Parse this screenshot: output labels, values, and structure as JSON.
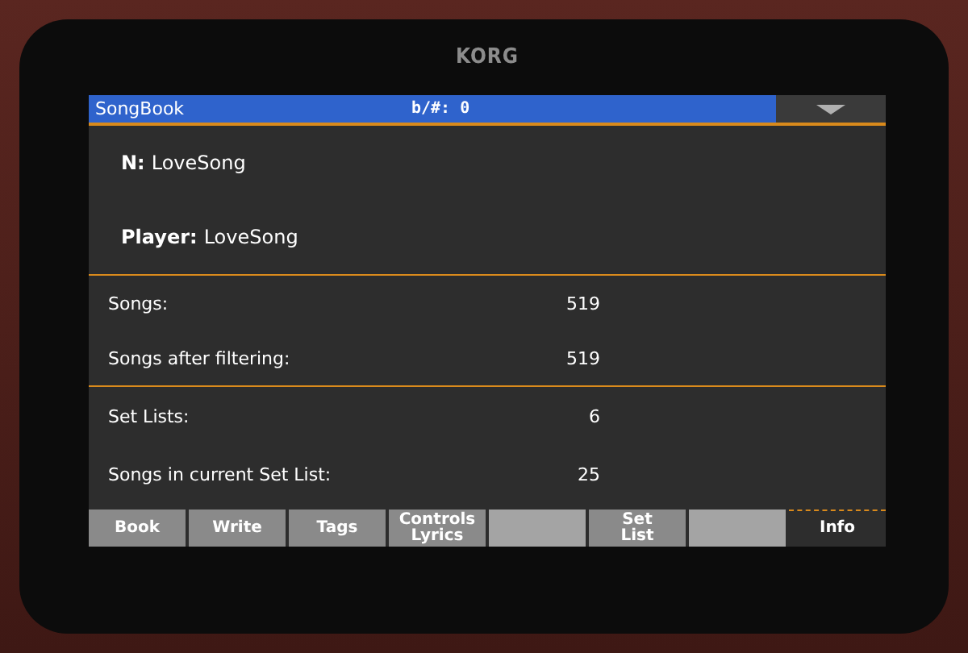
{
  "device": {
    "logo": "KORG"
  },
  "title_bar": {
    "title": "SongBook",
    "transpose": "b/#: 0"
  },
  "header": [
    {
      "label": "N:",
      "value": "LoveSong"
    },
    {
      "label": "Player:",
      "value": "LoveSong"
    }
  ],
  "sections": [
    [
      {
        "label": "Songs:",
        "value": "519"
      },
      {
        "label": "Songs after filtering:",
        "value": "519"
      }
    ],
    [
      {
        "label": "Set Lists:",
        "value": "6"
      },
      {
        "label": "Songs in current Set List:",
        "value": "25"
      }
    ]
  ],
  "tabs": [
    {
      "kind": "text",
      "label": "Book",
      "selected": false
    },
    {
      "kind": "text",
      "label": "Write",
      "selected": false
    },
    {
      "kind": "text",
      "label": "Tags",
      "selected": false
    },
    {
      "kind": "text",
      "label": "Controls\nLyrics",
      "selected": false
    },
    {
      "kind": "blank",
      "selected": false
    },
    {
      "kind": "text",
      "label": "Set\nList",
      "selected": false
    },
    {
      "kind": "blank",
      "selected": false
    },
    {
      "kind": "text",
      "label": "Info",
      "selected": true
    }
  ]
}
